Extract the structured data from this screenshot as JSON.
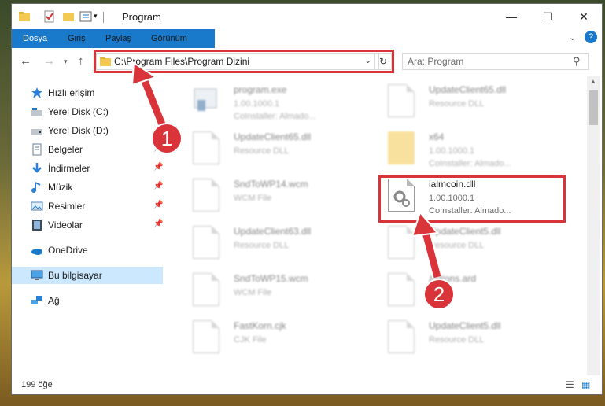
{
  "title": "Program",
  "ribbon_tabs": [
    "Dosya",
    "Giriş",
    "Paylaş",
    "Görünüm"
  ],
  "address": "C:\\Program Files\\Program Dizini",
  "search": {
    "placeholder": "Ara: Program"
  },
  "sidebar": {
    "items": [
      {
        "label": "Hızlı erişim",
        "icon": "star-icon"
      },
      {
        "label": "Yerel Disk (C:)",
        "icon": "drive-icon"
      },
      {
        "label": "Yerel Disk (D:)",
        "icon": "drive-icon"
      },
      {
        "label": "Belgeler",
        "icon": "documents-icon"
      },
      {
        "label": "İndirmeler",
        "icon": "download-icon"
      },
      {
        "label": "Müzik",
        "icon": "music-icon"
      },
      {
        "label": "Resimler",
        "icon": "pictures-icon"
      },
      {
        "label": "Videolar",
        "icon": "videos-icon"
      },
      {
        "label": "OneDrive",
        "icon": "cloud-icon"
      },
      {
        "label": "Bu bilgisayar",
        "icon": "computer-icon"
      },
      {
        "label": "Ağ",
        "icon": "network-icon"
      }
    ]
  },
  "files": [
    {
      "name": "program.exe",
      "line2": "1.00.1000.1",
      "line3": "CoInstaller: Almado..."
    },
    {
      "name": "UpdateClient65.dll",
      "line2": "Resource DLL",
      "line3": ""
    },
    {
      "name": "UpdateClient65.dll",
      "line2": "Resource DLL",
      "line3": ""
    },
    {
      "name": "x64",
      "line2": "1.00.1000.1",
      "line3": "CoInstaller: Almado..."
    },
    {
      "name": "SndToWP14.wcm",
      "line2": "WCM File",
      "line3": ""
    },
    {
      "name": "ialmcoin.dll",
      "line2": "1.00.1000.1",
      "line3": "CoInstaller: Almado..."
    },
    {
      "name": "UpdateClient63.dll",
      "line2": "Resource DLL",
      "line3": ""
    },
    {
      "name": "UpdateClient5.dll",
      "line2": "Resource DLL",
      "line3": ""
    },
    {
      "name": "SndToWP15.wcm",
      "line2": "WCM File",
      "line3": ""
    },
    {
      "name": "Actions.ard",
      "line2": "",
      "line3": ""
    },
    {
      "name": "FastKorn.cjk",
      "line2": "CJK File",
      "line3": ""
    },
    {
      "name": "UpdateClient5.dll",
      "line2": "Resource DLL",
      "line3": ""
    }
  ],
  "status": {
    "count": "199 öğe"
  },
  "callouts": [
    "1",
    "2"
  ],
  "colors": {
    "highlight": "#d9343a",
    "accent": "#1979ca"
  }
}
